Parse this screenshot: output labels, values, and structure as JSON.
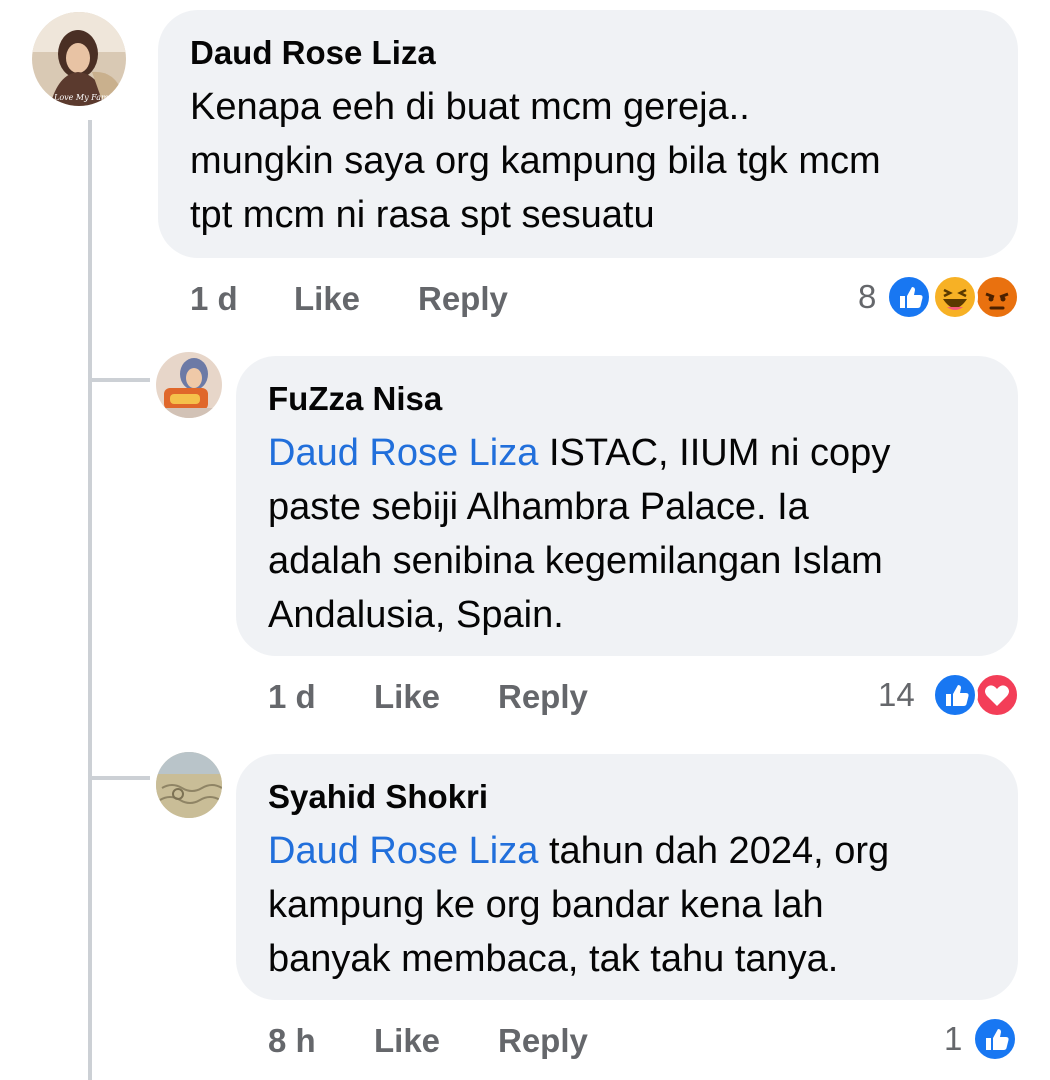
{
  "comments": [
    {
      "author": "Daud Rose Liza",
      "lines": [
        "Kenapa eeh di buat mcm gereja..",
        "mungkin saya org kampung bila tgk mcm",
        "tpt mcm ni rasa spt sesuatu"
      ],
      "time": "1 d",
      "like_label": "Like",
      "reply_label": "Reply",
      "reaction_count": "8",
      "reactions": [
        "like-icon",
        "haha-icon",
        "angry-icon"
      ]
    }
  ],
  "replies": [
    {
      "author": "FuZza Nisa",
      "mention": "Daud Rose Liza",
      "lines": [
        " ISTAC, IIUM ni copy",
        "paste sebiji Alhambra Palace. Ia",
        "adalah senibina kegemilangan Islam",
        "Andalusia, Spain."
      ],
      "time": "1 d",
      "like_label": "Like",
      "reply_label": "Reply",
      "reaction_count": "14",
      "reactions": [
        "like-icon",
        "love-icon"
      ]
    },
    {
      "author": "Syahid Shokri",
      "mention": "Daud Rose Liza",
      "lines": [
        " tahun dah 2024, org",
        "kampung ke org bandar kena lah",
        "banyak membaca, tak tahu tanya."
      ],
      "time": "8 h",
      "like_label": "Like",
      "reply_label": "Reply",
      "reaction_count": "1",
      "reactions": [
        "like-icon"
      ]
    }
  ],
  "colors": {
    "bubble": "#f0f2f5",
    "mention": "#216fdb",
    "meta": "#65676b",
    "like_blue": "#1877f2",
    "love_red": "#f33e58",
    "haha_yellow": "#f7b125",
    "angry_orange": "#e9710f"
  }
}
